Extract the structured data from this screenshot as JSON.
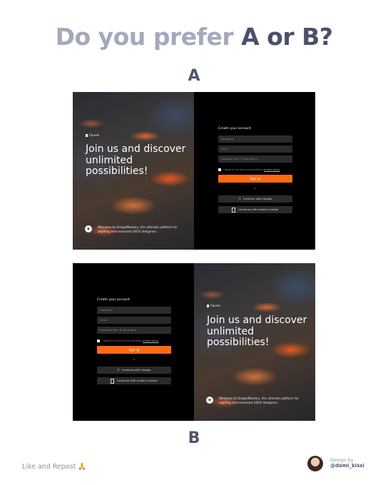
{
  "headline": {
    "lead": "Do you prefer",
    "choice": "A or B?"
  },
  "variants": {
    "a_label": "A",
    "b_label": "B"
  },
  "brand": "Course",
  "hero": {
    "title": "Join us and discover unlimited possibilities!",
    "welcome": "Welcome to DesignMastery, the ultimate platform for aspiring and seasoned UI/UX designers."
  },
  "form": {
    "title": "Create your account",
    "username_placeholder": "Username",
    "email_placeholder": "Email",
    "password_placeholder": "Password (min. 8 characters)",
    "terms_prefix": "I agree to the terms and conditions",
    "terms_link": "privacy policy",
    "signup_label": "Sign up",
    "or_label": "or",
    "google_label": "Continue with Google",
    "mobile_label": "Continue with mobile number"
  },
  "icons": {
    "google": "google-icon",
    "phone": "phone-icon",
    "brand": "brand-icon"
  },
  "colors": {
    "accent": "#ff6a13",
    "headline_light": "#a4a9bd",
    "headline_dark": "#4a5069"
  },
  "footer": {
    "left": "Like and Repost 🙏",
    "design_by": "Design by",
    "handle": "@domi_kissi"
  }
}
